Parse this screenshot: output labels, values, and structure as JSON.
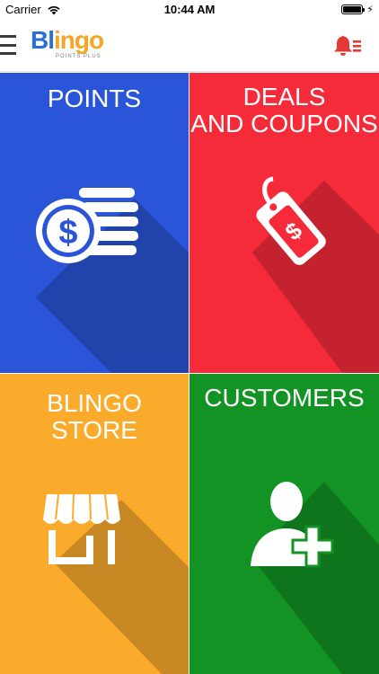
{
  "status_bar": {
    "carrier": "Carrier",
    "time": "10:44 AM",
    "charging_glyph": "⚡"
  },
  "nav": {
    "logo_text": [
      "B",
      "l",
      "i",
      "n",
      "g",
      "o"
    ],
    "logo_tagline": "POINTS PLUS",
    "menu_icon": "hamburger-menu-icon",
    "notification_icon": "bell-list-icon"
  },
  "tiles": [
    {
      "id": "points",
      "title": "POINTS",
      "icon": "coins-dollar-icon",
      "color": "#2a55d8"
    },
    {
      "id": "deals",
      "title": "DEALS\nAND COUPONS",
      "icon": "price-tag-icon",
      "color": "#f52b3a"
    },
    {
      "id": "store",
      "title": "BLINGO\nSTORE",
      "icon": "storefront-awning-icon",
      "color": "#fbab2c"
    },
    {
      "id": "customers",
      "title": "CUSTOMERS",
      "icon": "add-user-icon",
      "color": "#129324"
    }
  ],
  "colors": {
    "logo_blue": "#2a6fd8",
    "logo_orange": "#f5a623",
    "alert_red": "#e53935"
  }
}
